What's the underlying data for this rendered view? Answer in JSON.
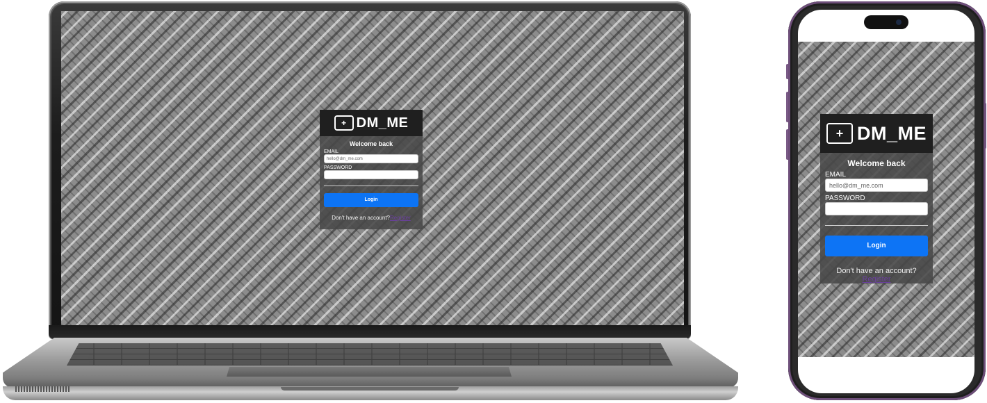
{
  "app": {
    "logo_icon": "+",
    "logo_text": "DM_ME"
  },
  "login": {
    "welcome": "Welcome back",
    "email_label": "EMAIL",
    "email_placeholder": "hello@dm_me.com",
    "password_label": "PASSWORD",
    "password_value": "",
    "login_button": "Login",
    "no_account_text": "Don't have an account?",
    "register_link": "Register"
  },
  "colors": {
    "primary_button": "#0d74f5",
    "card_header": "#1f1f1f",
    "link": "#6b3fa0",
    "phone_frame": "#6e4f7a"
  },
  "icons": [
    "chat-plus-icon"
  ]
}
